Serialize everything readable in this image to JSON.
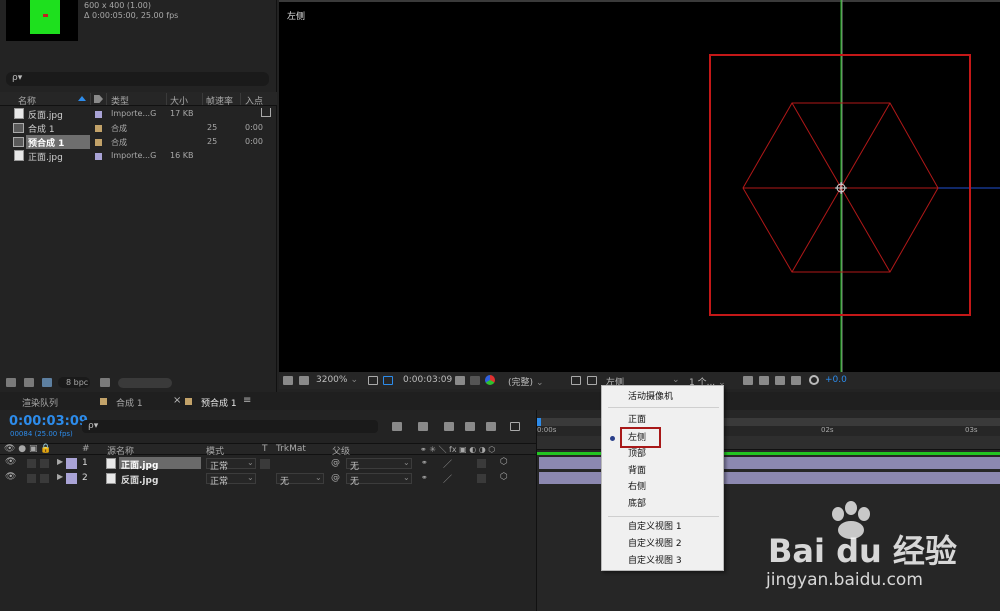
{
  "project": {
    "comp_size": "600 x 400 (1.00)",
    "comp_duration": "Δ 0:00:05:00, 25.00 fps",
    "search_placeholder": "ρ▾",
    "columns": {
      "name": "名称",
      "type": "类型",
      "size": "大小",
      "framerate": "帧速率",
      "inpoint": "入点"
    },
    "items": [
      {
        "name": "反面.jpg",
        "kind": "file",
        "swatch": "#a9a3d6",
        "type": "Importe...G",
        "size": "17 KB",
        "fps": "",
        "inpoint": ""
      },
      {
        "name": "合成 1",
        "kind": "comp",
        "swatch": "#c2a269",
        "type": "合成",
        "size": "",
        "fps": "25",
        "inpoint": "0:00"
      },
      {
        "name": "预合成 1",
        "kind": "comp",
        "swatch": "#c2a269",
        "type": "合成",
        "size": "",
        "fps": "25",
        "inpoint": "0:00"
      },
      {
        "name": "正面.jpg",
        "kind": "file",
        "swatch": "#a9a3d6",
        "type": "Importe...G",
        "size": "16 KB",
        "fps": "",
        "inpoint": ""
      }
    ],
    "bpc": "8 bpc"
  },
  "viewer": {
    "view_label": "左侧",
    "zoom": "3200%",
    "timecode": "0:00:03:09",
    "resolution": "(完整)",
    "view_select": "左侧",
    "views_count": "1 个...",
    "exposure": "+0.0"
  },
  "timeline": {
    "tabs": [
      {
        "label": "渲染队列",
        "active": false
      },
      {
        "label": "合成 1",
        "active": false,
        "swatch": "#c2a269"
      },
      {
        "label": "预合成 1",
        "active": true,
        "swatch": "#c2a269"
      }
    ],
    "timecode": "0:00:03:09",
    "frame_info": "00084 (25.00 fps)",
    "search_placeholder": "ρ▾",
    "columns": {
      "num": "#",
      "source": "源名称",
      "mode": "模式",
      "t": "T",
      "trkmat": "TrkMat",
      "parent": "父级"
    },
    "layers": [
      {
        "num": "1",
        "name": "正面.jpg",
        "mode": "正常",
        "trkmat": "",
        "parent": "无",
        "selected": true
      },
      {
        "num": "2",
        "name": "反面.jpg",
        "mode": "正常",
        "trkmat": "无",
        "parent": "无",
        "selected": false
      }
    ],
    "ruler": [
      "0:00s",
      "02s",
      "03s"
    ]
  },
  "context_menu": {
    "items": [
      {
        "label": "活动摄像机",
        "selected": false
      },
      {
        "label": "正面",
        "selected": false
      },
      {
        "label": "左侧",
        "selected": true
      },
      {
        "label": "顶部",
        "selected": false
      },
      {
        "label": "背面",
        "selected": false
      },
      {
        "label": "右侧",
        "selected": false
      },
      {
        "label": "底部",
        "selected": false
      },
      {
        "label": "自定义视图 1",
        "selected": false
      },
      {
        "label": "自定义视图 2",
        "selected": false
      },
      {
        "label": "自定义视图 3",
        "selected": false
      }
    ]
  },
  "watermark": {
    "brand": "Bai du 经验",
    "url": "jingyan.baidu.com"
  },
  "colors": {
    "accent_blue": "#2d8ceb",
    "highlight_red": "#c41818",
    "layer_bar": "#8c88b0",
    "green_axis": "#22c522"
  }
}
